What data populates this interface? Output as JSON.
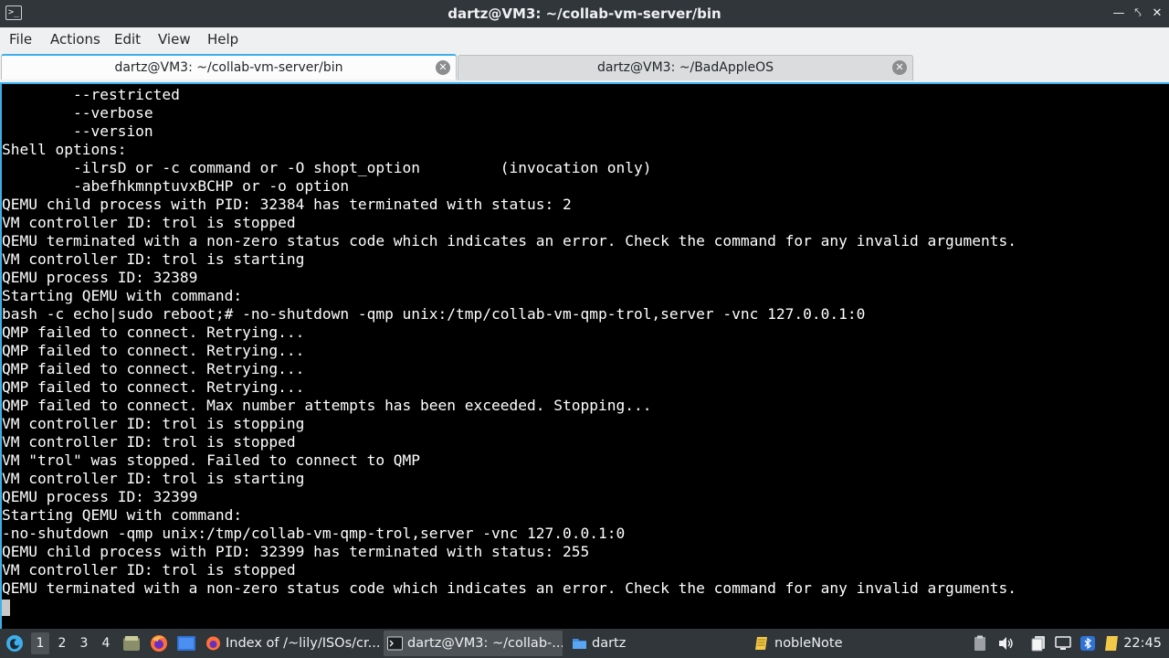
{
  "window": {
    "title": "dartz@VM3: ~/collab-vm-server/bin",
    "app_icon_glyph": ">_",
    "minimize_glyph": "—",
    "restore_glyph": "⤣",
    "close_glyph": "✕"
  },
  "menu": {
    "file": "File",
    "actions": "Actions",
    "edit": "Edit",
    "view": "View",
    "help": "Help"
  },
  "tabs": [
    {
      "label": "dartz@VM3: ~/collab-vm-server/bin",
      "active": true
    },
    {
      "label": "dartz@VM3: ~/BadAppleOS",
      "active": false
    }
  ],
  "tab_close_glyph": "✕",
  "terminal": {
    "lines": [
      "        --restricted",
      "        --verbose",
      "        --version",
      "Shell options:",
      "        -ilrsD or -c command or -O shopt_option         (invocation only)",
      "        -abefhkmnptuvxBCHP or -o option",
      "QEMU child process with PID: 32384 has terminated with status: 2",
      "VM controller ID: trol is stopped",
      "QEMU terminated with a non-zero status code which indicates an error. Check the command for any invalid arguments.",
      "VM controller ID: trol is starting",
      "QEMU process ID: 32389",
      "Starting QEMU with command:",
      "bash -c echo|sudo reboot;# -no-shutdown -qmp unix:/tmp/collab-vm-qmp-trol,server -vnc 127.0.0.1:0",
      "QMP failed to connect. Retrying...",
      "QMP failed to connect. Retrying...",
      "QMP failed to connect. Retrying...",
      "QMP failed to connect. Retrying...",
      "QMP failed to connect. Max number attempts has been exceeded. Stopping...",
      "VM controller ID: trol is stopping",
      "VM controller ID: trol is stopped",
      "VM \"trol\" was stopped. Failed to connect to QMP",
      "VM controller ID: trol is starting",
      "QEMU process ID: 32399",
      "Starting QEMU with command:",
      "-no-shutdown -qmp unix:/tmp/collab-vm-qmp-trol,server -vnc 127.0.0.1:0",
      "QEMU child process with PID: 32399 has terminated with status: 255",
      "VM controller ID: trol is stopped",
      "QEMU terminated with a non-zero status code which indicates an error. Check the command for any invalid arguments."
    ]
  },
  "taskbar": {
    "desktops": [
      "1",
      "2",
      "3",
      "4"
    ],
    "active_desktop": "1",
    "tasks": [
      {
        "label": "Index of /~lily/ISOs/cr...",
        "icon": "firefox-icon",
        "active": false
      },
      {
        "label": "dartz@VM3: ~/collab-...",
        "icon": "terminal-icon",
        "active": true
      },
      {
        "label": "dartz",
        "icon": "folder-icon",
        "active": false
      },
      {
        "label": "nobleNote",
        "icon": "note-icon",
        "active": false
      }
    ],
    "clock": "22:45",
    "tray_icons": [
      "clipboard-icon",
      "volume-icon",
      "files-icon",
      "network-icon",
      "bluetooth-icon",
      "notes-icon"
    ]
  },
  "colors": {
    "accent": "#3daee9",
    "terminal_bg": "#000000",
    "terminal_fg": "#ffffff",
    "titlebar_bg": "#31363b",
    "menubar_bg": "#eff0f1"
  }
}
